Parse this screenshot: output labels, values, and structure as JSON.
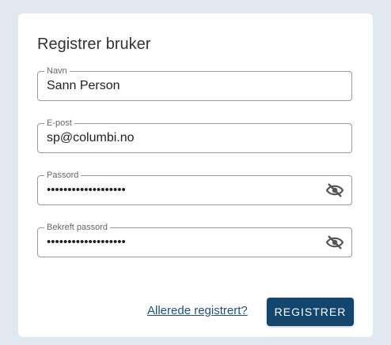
{
  "form": {
    "title": "Registrer bruker",
    "fields": [
      {
        "label": "Navn",
        "value": "Sann Person"
      },
      {
        "label": "E-post",
        "value": "sp@columbi.no"
      },
      {
        "label": "Passord",
        "value": "•••••••••••••••••••"
      },
      {
        "label": "Bekreft passord",
        "value": "•••••••••••••••••••"
      }
    ],
    "already_registered_link": "Allerede registrert?",
    "submit_label": "REGISTRER"
  },
  "icons": {
    "password_toggle": "eye-off-icon"
  },
  "colors": {
    "background": "#e2e8f0",
    "button": "#13466f",
    "link": "#1f4f7a"
  }
}
